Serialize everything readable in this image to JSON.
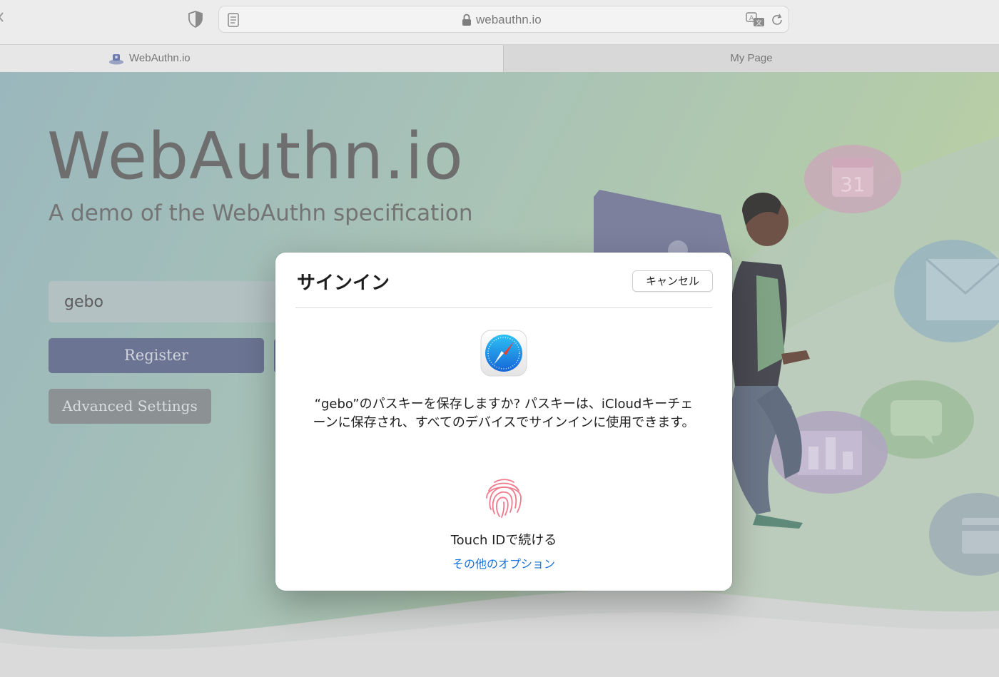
{
  "browser": {
    "url": "webauthn.io",
    "tabs": [
      {
        "label": "WebAuthn.io",
        "active": true
      },
      {
        "label": "My Page",
        "active": false
      }
    ]
  },
  "page": {
    "title": "WebAuthn.io",
    "subtitle": "A demo of the WebAuthn specification",
    "username_value": "gebo",
    "register_label": "Register",
    "advanced_label": "Advanced Settings"
  },
  "dialog": {
    "title": "サインイン",
    "cancel_label": "キャンセル",
    "message": "“gebo”のパスキーを保存しますか? パスキーは、iCloudキーチェーンに保存され、すべてのデバイスでサインインに使用できます。",
    "touch_id_label": "Touch IDで続ける",
    "other_options_label": "その他のオプション"
  },
  "illustration": {
    "calendar_day": "31"
  },
  "colors": {
    "link": "#1a73d8",
    "button": "#6b7492",
    "overlay_bg": "#9fb7ba"
  }
}
